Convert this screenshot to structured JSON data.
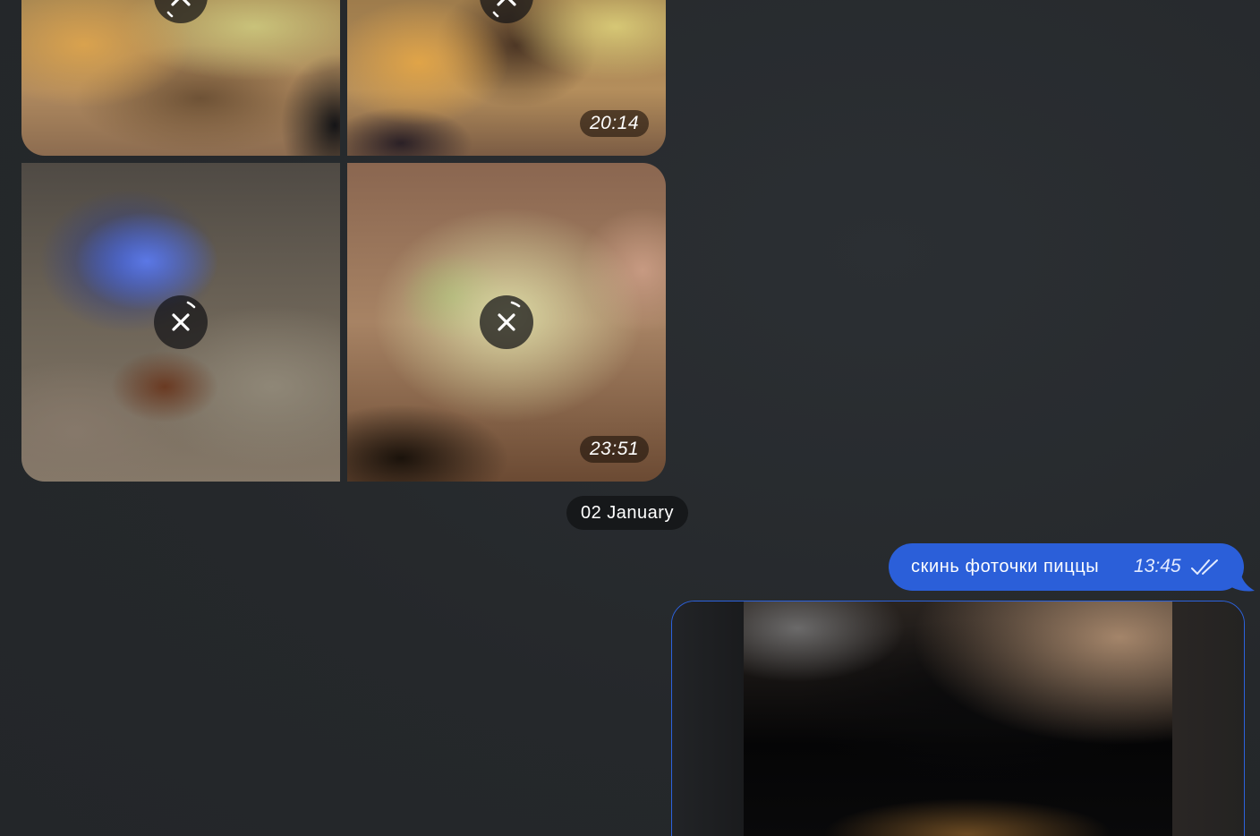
{
  "album": {
    "photos": [
      {
        "name": "photo-1",
        "time": ""
      },
      {
        "name": "photo-2",
        "time": "20:14"
      },
      {
        "name": "photo-3",
        "time": ""
      },
      {
        "name": "photo-4",
        "time": "23:51"
      }
    ]
  },
  "date_separator": {
    "label": "02 January"
  },
  "outgoing_message": {
    "text": "скинь фоточки пиццы",
    "time": "13:45",
    "status_icon": "double-check-icon"
  },
  "colors": {
    "background": "#26292c",
    "outgoing_bubble": "#2b5fd9",
    "date_pill": "#16181a"
  }
}
